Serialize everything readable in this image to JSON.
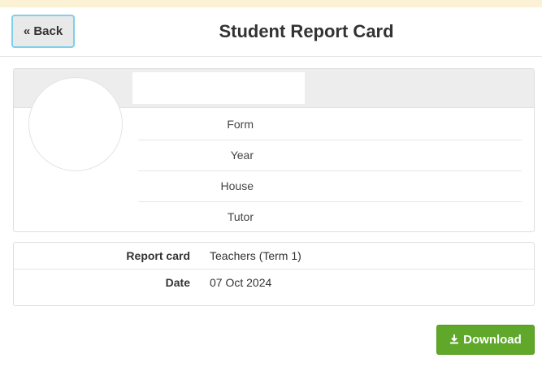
{
  "header": {
    "back_label": "« Back",
    "title": "Student Report Card"
  },
  "profile": {
    "details": [
      {
        "label": "Form"
      },
      {
        "label": "Year"
      },
      {
        "label": "House"
      },
      {
        "label": "Tutor"
      }
    ]
  },
  "report": {
    "rows": [
      {
        "label": "Report card",
        "value": "Teachers (Term 1)"
      },
      {
        "label": "Date",
        "value": "07 Oct 2024"
      }
    ]
  },
  "actions": {
    "download_label": "Download",
    "download_icon": "download-icon"
  },
  "colors": {
    "top_strip": "#fbf1d4",
    "back_border": "#7fd0ea",
    "download_bg": "#5fa82a"
  }
}
